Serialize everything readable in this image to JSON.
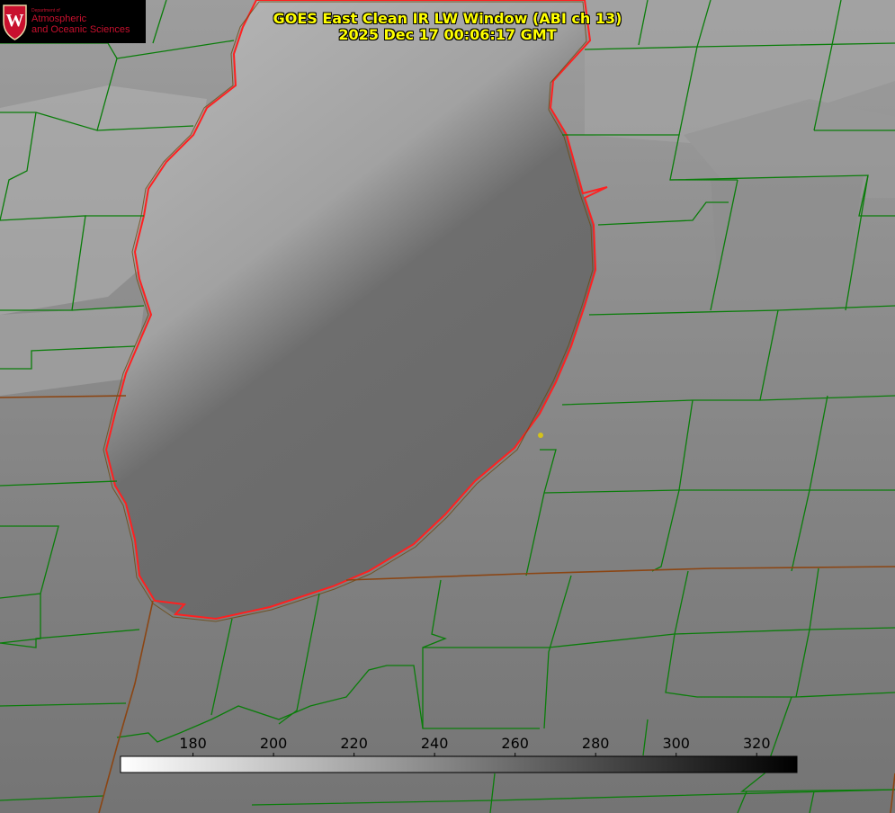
{
  "title": {
    "line1": "GOES East Clean IR LW Window (ABI ch 13)",
    "line2": "2025 Dec 17 00:06:17 GMT"
  },
  "logo": {
    "department": "Department of",
    "line1": "Atmospheric",
    "line2": "and Oceanic Sciences"
  },
  "colorbar": {
    "ticks": [
      "180",
      "200",
      "220",
      "240",
      "260",
      "280",
      "300",
      "320"
    ],
    "min_value": 162,
    "max_value": 330,
    "gradient": [
      "#ffffff",
      "#000000"
    ]
  },
  "colors": {
    "county_lines": "#0a7d0a",
    "state_lines": "#8b4513",
    "lake_outline": "#ff2020",
    "title_text": "#ffff00",
    "marker": "#d4c21a"
  }
}
